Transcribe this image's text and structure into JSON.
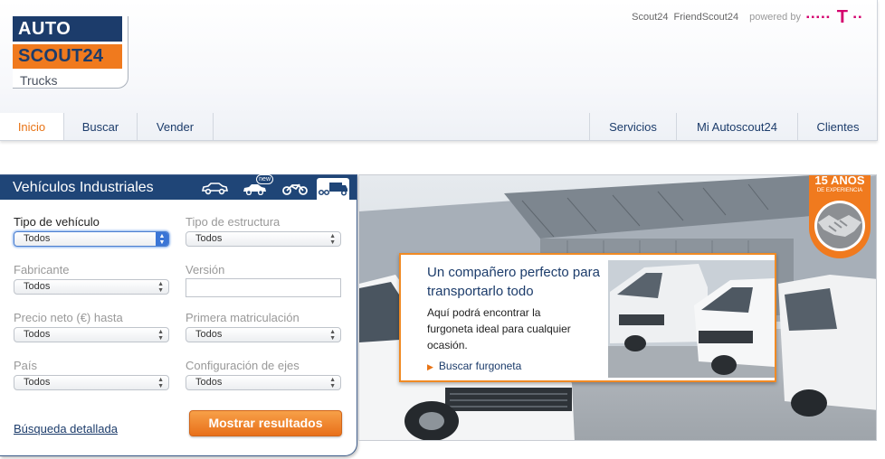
{
  "logo": {
    "line1": "AUTO",
    "line2": "SCOUT24",
    "line3": "Trucks"
  },
  "top_links": {
    "scout": "Scout24",
    "friend": "FriendScout24",
    "powered_by": "powered by",
    "t_logo": "T"
  },
  "nav": {
    "left": [
      {
        "label": "Inicio",
        "active": true
      },
      {
        "label": "Buscar",
        "active": false
      },
      {
        "label": "Vender",
        "active": false
      }
    ],
    "right": [
      {
        "label": "Servicios"
      },
      {
        "label": "Mi Autoscout24"
      },
      {
        "label": "Clientes"
      }
    ]
  },
  "search": {
    "title": "Vehículos Industriales",
    "tabs": [
      {
        "icon": "car-icon"
      },
      {
        "icon": "new-car-icon",
        "badge": "new"
      },
      {
        "icon": "motorbike-icon"
      },
      {
        "icon": "truck-icon",
        "active": true
      }
    ],
    "fields": [
      {
        "label": "Tipo de vehículo",
        "value": "Todos",
        "label_dark": true,
        "focused": true
      },
      {
        "label": "Tipo de estructura",
        "value": "Todos"
      },
      {
        "label": "Fabricante",
        "value": "Todos"
      },
      {
        "label": "Versión",
        "value": "",
        "type": "input"
      },
      {
        "label": "Precio neto (€) hasta",
        "value": "Todos"
      },
      {
        "label": "Primera matriculación",
        "value": "Todos"
      },
      {
        "label": "País",
        "value": "Todos"
      },
      {
        "label": "Configuración de ejes",
        "value": "Todos"
      }
    ],
    "detail_link": "Búsqueda detallada",
    "submit": "Mostrar resultados"
  },
  "banner": {
    "badge_line1": "15 AÑOS",
    "badge_line2": "DE EXPERIENCIA",
    "promo_title": "Un compañero perfecto para transportarlo todo",
    "promo_body": "Aquí podrá encontrar la furgoneta ideal para cualquier ocasión.",
    "promo_link": "Buscar furgoneta"
  },
  "colors": {
    "brand_blue": "#1c3c6b",
    "brand_orange": "#f07a1e",
    "telekom_magenta": "#d4006d"
  }
}
